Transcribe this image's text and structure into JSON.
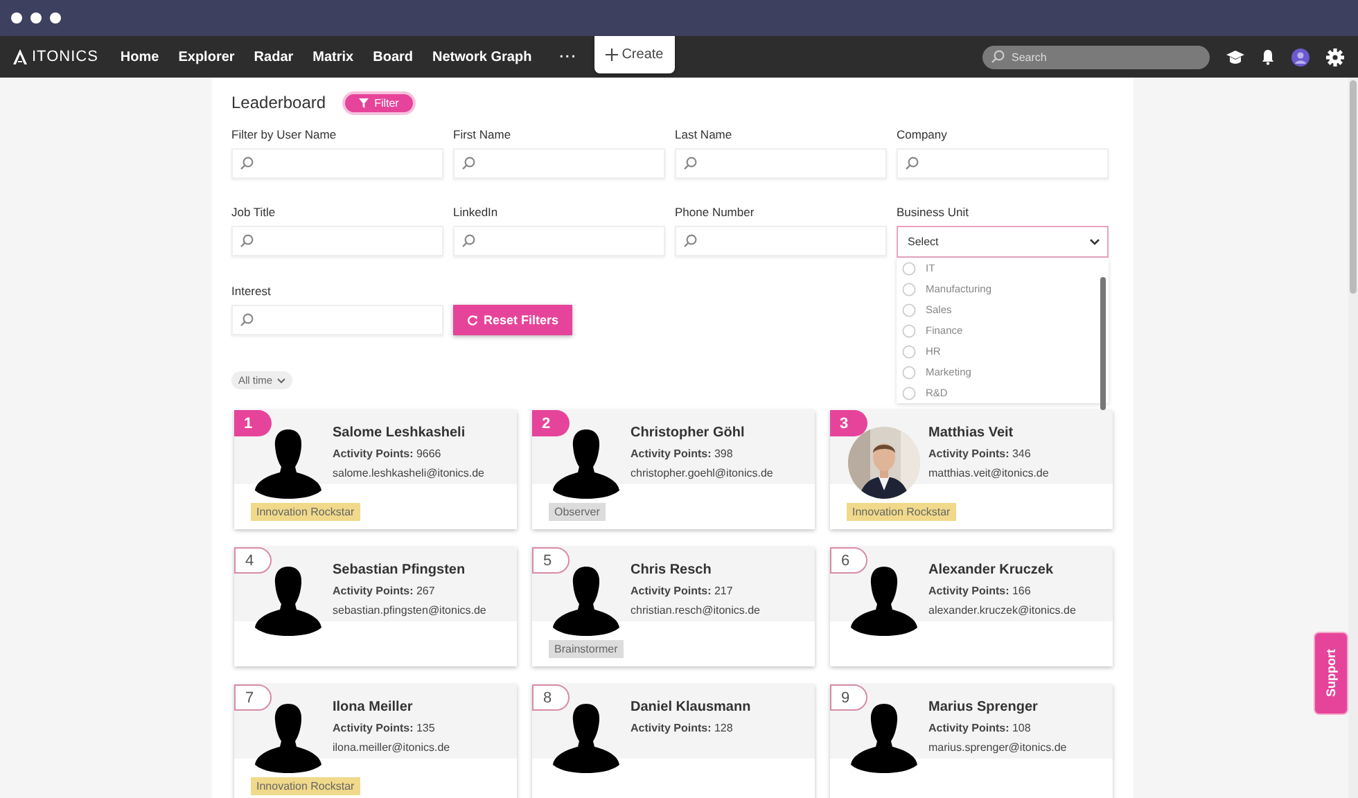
{
  "nav": {
    "logo": "ITONICS",
    "items": [
      {
        "label": "Home",
        "selected": false
      },
      {
        "label": "Explorer",
        "selected": false
      },
      {
        "label": "Radar",
        "selected": false
      },
      {
        "label": "Matrix",
        "selected": false
      },
      {
        "label": "Board",
        "selected": false
      },
      {
        "label": "Network Graph",
        "selected": false
      }
    ],
    "more": "···",
    "create": "Create",
    "search": {
      "placeholder": "Search"
    }
  },
  "leaderboard": {
    "title": "Leaderboard",
    "filter_button": "Filter",
    "filters": [
      {
        "label": "Filter by User Name",
        "kind": "search"
      },
      {
        "label": "First Name",
        "kind": "search"
      },
      {
        "label": "Last Name",
        "kind": "search"
      },
      {
        "label": "Company",
        "kind": "search"
      },
      {
        "label": "Job Title",
        "kind": "search"
      },
      {
        "label": "LinkedIn",
        "kind": "search"
      },
      {
        "label": "Phone Number",
        "kind": "search"
      },
      {
        "label": "Business Unit",
        "kind": "select",
        "value": "Select",
        "expanded": true,
        "options": [
          {
            "label": "IT",
            "selected": false
          },
          {
            "label": "Manufacturing",
            "selected": false
          },
          {
            "label": "Sales",
            "selected": false
          },
          {
            "label": "Finance",
            "selected": false
          },
          {
            "label": "HR",
            "selected": false
          },
          {
            "label": "Marketing",
            "selected": false
          },
          {
            "label": "R&D",
            "selected": false
          }
        ]
      },
      {
        "label": "Interest",
        "kind": "search"
      }
    ],
    "reset_button": "Reset Filters",
    "period": "All time",
    "cards": [
      {
        "rank": "1",
        "top": true,
        "avatar": {
          "kind": "silhouette"
        },
        "points_label": "Activity Points:",
        "name": "Salome Leshkasheli",
        "points": "9666",
        "email": "salome.leshkasheli@itonics.de",
        "badge": {
          "text": "Innovation Rockstar",
          "color": "#f0d98a"
        }
      },
      {
        "rank": "2",
        "top": true,
        "avatar": {
          "kind": "silhouette"
        },
        "points_label": "Activity Points:",
        "name": "Christopher Göhl",
        "points": "398",
        "email": "christopher.goehl@itonics.de",
        "badge": {
          "text": "Observer",
          "color": "#dcdcdc"
        }
      },
      {
        "rank": "3",
        "top": true,
        "points_label": "Activity Points:",
        "name": "Matthias Veit",
        "points": "346",
        "email": "matthias.veit@itonics.de",
        "badge": {
          "text": "Innovation Rockstar",
          "color": "#f0d98a"
        }
      },
      {
        "rank": "4",
        "top": false,
        "avatar": {
          "kind": "silhouette"
        },
        "points_label": "Activity Points:",
        "name": "Sebastian Pfingsten",
        "points": "267",
        "email": "sebastian.pfingsten@itonics.de"
      },
      {
        "rank": "5",
        "top": false,
        "avatar": {
          "kind": "silhouette"
        },
        "points_label": "Activity Points:",
        "name": "Chris Resch",
        "points": "217",
        "email": "christian.resch@itonics.de",
        "badge": {
          "text": "Brainstormer",
          "color": "#dcdcdc"
        }
      },
      {
        "rank": "6",
        "top": false,
        "avatar": {
          "kind": "silhouette"
        },
        "points_label": "Activity Points:",
        "name": "Alexander Kruczek",
        "points": "166",
        "email": "alexander.kruczek@itonics.de"
      },
      {
        "rank": "7",
        "top": false,
        "avatar": {
          "kind": "silhouette"
        },
        "points_label": "Activity Points:",
        "name": "Ilona Meiller",
        "points": "135",
        "email": "ilona.meiller@itonics.de",
        "badge": {
          "text": "Innovation Rockstar",
          "color": "#f0d98a"
        }
      },
      {
        "rank": "8",
        "top": false,
        "avatar": {
          "kind": "silhouette"
        },
        "points_label": "Activity Points:",
        "name": "Daniel Klausmann",
        "points": "128"
      },
      {
        "rank": "9",
        "top": false,
        "avatar": {
          "kind": "silhouette"
        },
        "points_label": "Activity Points:",
        "name": "Marius Sprenger",
        "points": "108",
        "email": "marius.sprenger@itonics.de"
      }
    ]
  },
  "support": "Support"
}
